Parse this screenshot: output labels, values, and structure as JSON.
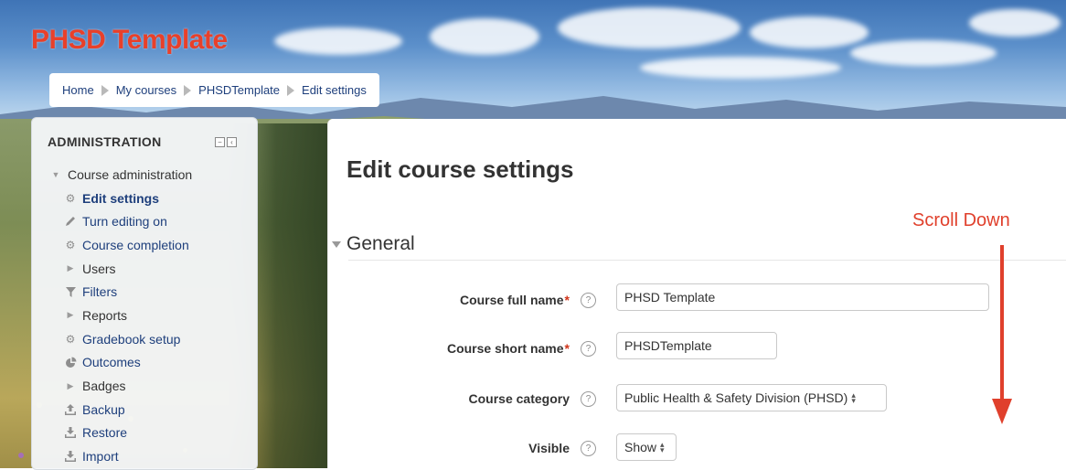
{
  "site": {
    "title": "PHSD Template"
  },
  "breadcrumb": [
    "Home",
    "My courses",
    "PHSDTemplate",
    "Edit settings"
  ],
  "admin": {
    "heading": "ADMINISTRATION",
    "section": "Course administration",
    "items": [
      {
        "label": "Edit settings",
        "icon": "gear-icon",
        "style": "active"
      },
      {
        "label": "Turn editing on",
        "icon": "pencil-icon",
        "style": "link"
      },
      {
        "label": "Course completion",
        "icon": "gear-icon",
        "style": "link"
      },
      {
        "label": "Users",
        "icon": "caret-right-icon",
        "style": "plain"
      },
      {
        "label": "Filters",
        "icon": "funnel-icon",
        "style": "link"
      },
      {
        "label": "Reports",
        "icon": "caret-right-icon",
        "style": "plain"
      },
      {
        "label": "Gradebook setup",
        "icon": "gear-icon",
        "style": "link"
      },
      {
        "label": "Outcomes",
        "icon": "pie-chart-icon",
        "style": "link"
      },
      {
        "label": "Badges",
        "icon": "caret-right-icon",
        "style": "plain"
      },
      {
        "label": "Backup",
        "icon": "upload-icon",
        "style": "link"
      },
      {
        "label": "Restore",
        "icon": "download-icon",
        "style": "link"
      },
      {
        "label": "Import",
        "icon": "download-icon",
        "style": "link"
      }
    ]
  },
  "main": {
    "heading": "Edit course settings",
    "section": "General",
    "fields": {
      "full_name": {
        "label": "Course full name",
        "required": "*",
        "value": "PHSD Template"
      },
      "short_name": {
        "label": "Course short name",
        "required": "*",
        "value": "PHSDTemplate"
      },
      "category": {
        "label": "Course category",
        "value": "Public Health & Safety Division (PHSD)"
      },
      "visible": {
        "label": "Visible",
        "value": "Show"
      }
    }
  },
  "annotation": {
    "text": "Scroll Down"
  },
  "colors": {
    "title": "#e8402a",
    "link": "#1e3f7c",
    "annotation": "#e0402c"
  }
}
